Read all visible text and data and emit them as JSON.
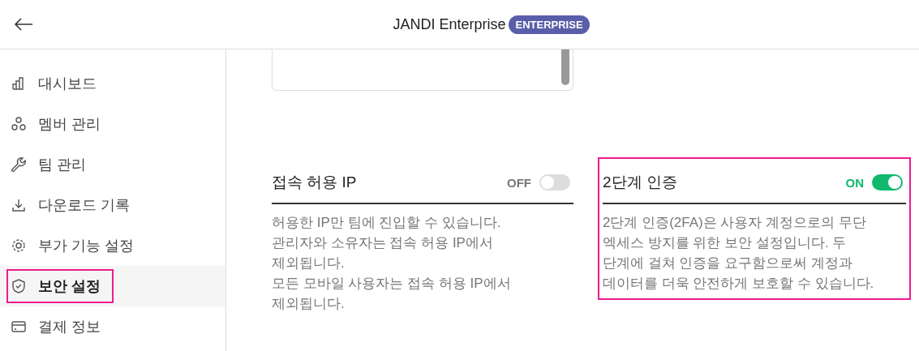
{
  "header": {
    "title": "JANDI Enterprise",
    "badge": "ENTERPRISE"
  },
  "sidebar": {
    "items": [
      {
        "kind": "chart",
        "label": "대시보드",
        "selected": false,
        "highlighted": false
      },
      {
        "kind": "members",
        "label": "멤버 관리",
        "selected": false,
        "highlighted": false
      },
      {
        "kind": "wrench",
        "label": "팀 관리",
        "selected": false,
        "highlighted": false
      },
      {
        "kind": "download",
        "label": "다운로드 기록",
        "selected": false,
        "highlighted": false
      },
      {
        "kind": "gear",
        "label": "부가 기능 설정",
        "selected": false,
        "highlighted": false
      },
      {
        "kind": "shield",
        "label": "보안 설정",
        "selected": true,
        "highlighted": true
      },
      {
        "kind": "card",
        "label": "결제 정보",
        "selected": false,
        "highlighted": false
      }
    ]
  },
  "settings": [
    {
      "title": "접속 허용 IP",
      "toggle_label": "OFF",
      "on": false,
      "highlighted": false,
      "description_lines": [
        "허용한 IP만 팀에 진입할 수 있습니다.",
        "관리자와 소유자는 접속 허용 IP에서",
        "제외됩니다.",
        "모든 모바일 사용자는 접속 허용 IP에서",
        "제외됩니다."
      ]
    },
    {
      "title": "2단계 인증",
      "toggle_label": "ON",
      "on": true,
      "highlighted": true,
      "description_lines": [
        "2단계 인증(2FA)은 사용자 계정으로의 무단",
        "엑세스 방지를 위한 보안 설정입니다. 두",
        "단계에 걸쳐 인증을 요구함으로써 계정과",
        "데이터를 더욱 안전하게 보호할 수 있습니다."
      ]
    }
  ]
}
